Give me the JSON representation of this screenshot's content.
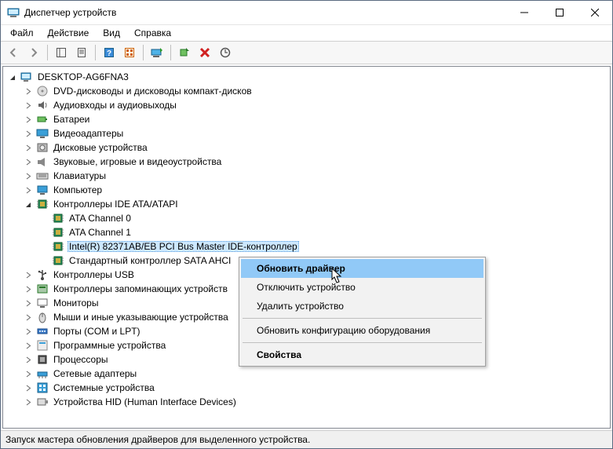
{
  "window": {
    "title": "Диспетчер устройств"
  },
  "menu": {
    "file": "Файл",
    "action": "Действие",
    "view": "Вид",
    "help": "Справка"
  },
  "tree": {
    "root": "DESKTOP-AG6FNA3",
    "items": [
      {
        "label": "DVD-дисководы и дисководы компакт-дисков",
        "icon": "disc"
      },
      {
        "label": "Аудиовходы и аудиовыходы",
        "icon": "audio"
      },
      {
        "label": "Батареи",
        "icon": "battery"
      },
      {
        "label": "Видеоадаптеры",
        "icon": "display"
      },
      {
        "label": "Дисковые устройства",
        "icon": "hdd"
      },
      {
        "label": "Звуковые, игровые и видеоустройства",
        "icon": "sound"
      },
      {
        "label": "Клавиатуры",
        "icon": "keyboard"
      },
      {
        "label": "Компьютер",
        "icon": "computer"
      },
      {
        "label": "Контроллеры IDE ATA/ATAPI",
        "icon": "chip",
        "expanded": true,
        "children": [
          {
            "label": "ATA Channel 0",
            "icon": "chip"
          },
          {
            "label": "ATA Channel 1",
            "icon": "chip"
          },
          {
            "label": "Intel(R) 82371AB/EB PCI Bus Master IDE-контроллер",
            "icon": "chip",
            "selected": true
          },
          {
            "label": "Стандартный контроллер SATA AHCI",
            "icon": "chip"
          }
        ]
      },
      {
        "label": "Контроллеры USB",
        "icon": "usb"
      },
      {
        "label": "Контроллеры запоминающих устройств",
        "icon": "storage"
      },
      {
        "label": "Мониторы",
        "icon": "monitor"
      },
      {
        "label": "Мыши и иные указывающие устройства",
        "icon": "mouse"
      },
      {
        "label": "Порты (COM и LPT)",
        "icon": "port"
      },
      {
        "label": "Программные устройства",
        "icon": "software"
      },
      {
        "label": "Процессоры",
        "icon": "cpu"
      },
      {
        "label": "Сетевые адаптеры",
        "icon": "network"
      },
      {
        "label": "Системные устройства",
        "icon": "system"
      },
      {
        "label": "Устройства HID (Human Interface Devices)",
        "icon": "hid"
      }
    ]
  },
  "context_menu": {
    "update": "Обновить драйвер",
    "disable": "Отключить устройство",
    "uninstall": "Удалить устройство",
    "scan": "Обновить конфигурацию оборудования",
    "properties": "Свойства"
  },
  "status": "Запуск мастера обновления драйверов для выделенного устройства."
}
